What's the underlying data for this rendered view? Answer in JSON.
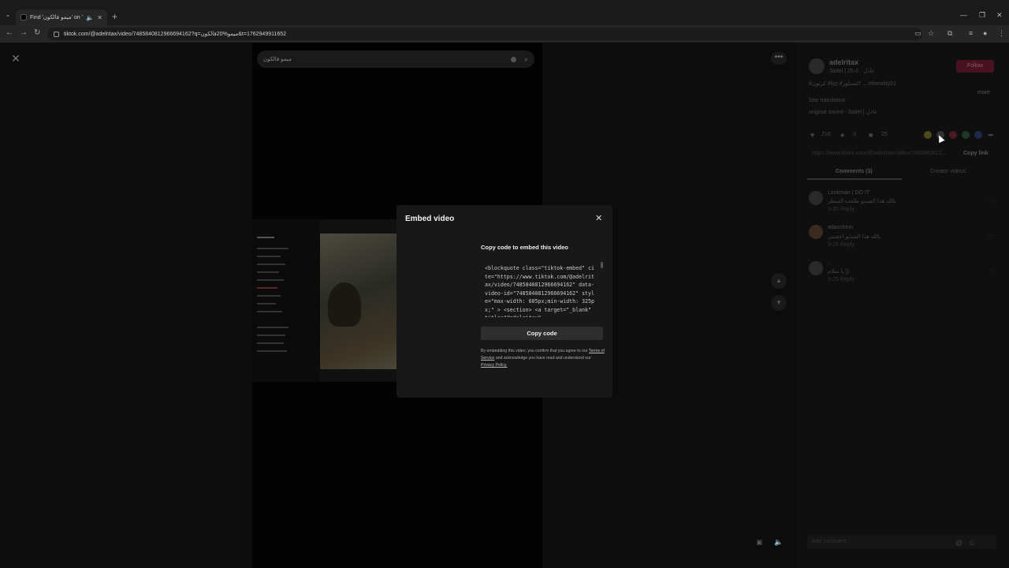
{
  "browser": {
    "tab_title": "Find 'ميمو فالكون' on TikTok",
    "url": "tiktok.com/@adelritax/video/7485840812966694162?q=ميمو%20فالكون&t=1762949911652"
  },
  "page": {
    "search": {
      "query": "ميمو فالكون"
    }
  },
  "right_panel": {
    "username": "adelritax",
    "user_sub": "3adel | عادل · 3-25",
    "follow_label": "Follow",
    "caption": "#كرتون #fyp #اكسبلور ... #thewitty21",
    "more_label": "more",
    "see_translation": "See translation",
    "sound": "original sound - 3adel | عادل",
    "likes": "216",
    "comments_count": "3",
    "saves": "25",
    "link_text": "https://www.tiktok.com/@adelritax/video/7485840812...",
    "copy_link_label": "Copy link",
    "tab_comments": "Comments (3)",
    "tab_creator": "Creator videos",
    "comment_input_placeholder": "Add comment...",
    "comments": [
      {
        "author": "Lookman | DO IT",
        "text": "يالله هذا الفيديو طلعت السطر",
        "meta": "3-25   Reply"
      },
      {
        "author": "adacchino",
        "text": "يالله هذا الفيديو اعجبني",
        "meta": "3-25   Reply"
      },
      {
        "author": "..",
        "text": "يا سلام ))",
        "meta": "3-25   Reply"
      }
    ]
  },
  "modal": {
    "title": "Embed video",
    "subtitle": "Copy code to embed this video",
    "code": "<blockquote class=\"tiktok-embed\" cite=\"https://www.tiktok.com/@adelritax/video/7485840812966694162\" data-video-id=\"7485840812966694162\" style=\"max-width: 605px;min-width: 325px;\" > <section> <a target=\"_blank\" title=\"@adelritax\"",
    "copy_button": "Copy code",
    "legal_1": "By embedding this video, you confirm that you agree to our ",
    "terms_link": "Terms of Service",
    "legal_2": " and acknowledge you have read and understood our ",
    "privacy_link": "Privacy Policy.",
    "close_icon": "close-icon"
  }
}
